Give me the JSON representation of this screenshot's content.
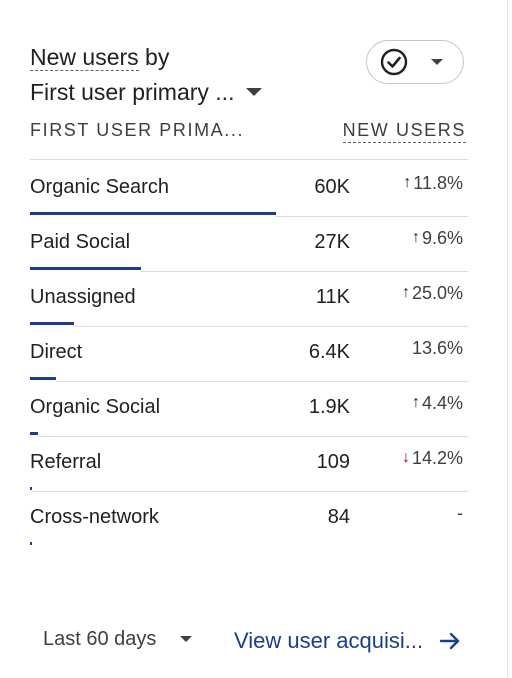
{
  "card": {
    "title_part1": "New users",
    "title_part2": " by",
    "dimension_label": "First user primary ...",
    "compare_button_icon": "check-circle-icon"
  },
  "table": {
    "col_dimension": "FIRST USER PRIMA...",
    "col_metric": "NEW USERS",
    "rows": [
      {
        "label": "Organic Search",
        "value": "60K",
        "change": "11.8%",
        "direction": "up",
        "share": 1.0
      },
      {
        "label": "Paid Social",
        "value": "27K",
        "change": "9.6%",
        "direction": "up",
        "share": 0.45
      },
      {
        "label": "Unassigned",
        "value": "11K",
        "change": "25.0%",
        "direction": "up",
        "share": 0.18
      },
      {
        "label": "Direct",
        "value": "6.4K",
        "change": "13.6%",
        "direction": "none",
        "share": 0.107
      },
      {
        "label": "Organic Social",
        "value": "1.9K",
        "change": "4.4%",
        "direction": "up",
        "share": 0.032
      },
      {
        "label": "Referral",
        "value": "109",
        "change": "14.2%",
        "direction": "down",
        "share": 0.002
      },
      {
        "label": "Cross-network",
        "value": "84",
        "change": "-",
        "direction": "none",
        "share": 0.0014
      }
    ]
  },
  "footer": {
    "date_range": "Last 60 days",
    "link_label": "View user acquisi..."
  },
  "colors": {
    "bar": "#1a3d8f",
    "link": "#1a3d8f",
    "up_arrow": "#202124",
    "down_arrow": "#a50e0e"
  }
}
